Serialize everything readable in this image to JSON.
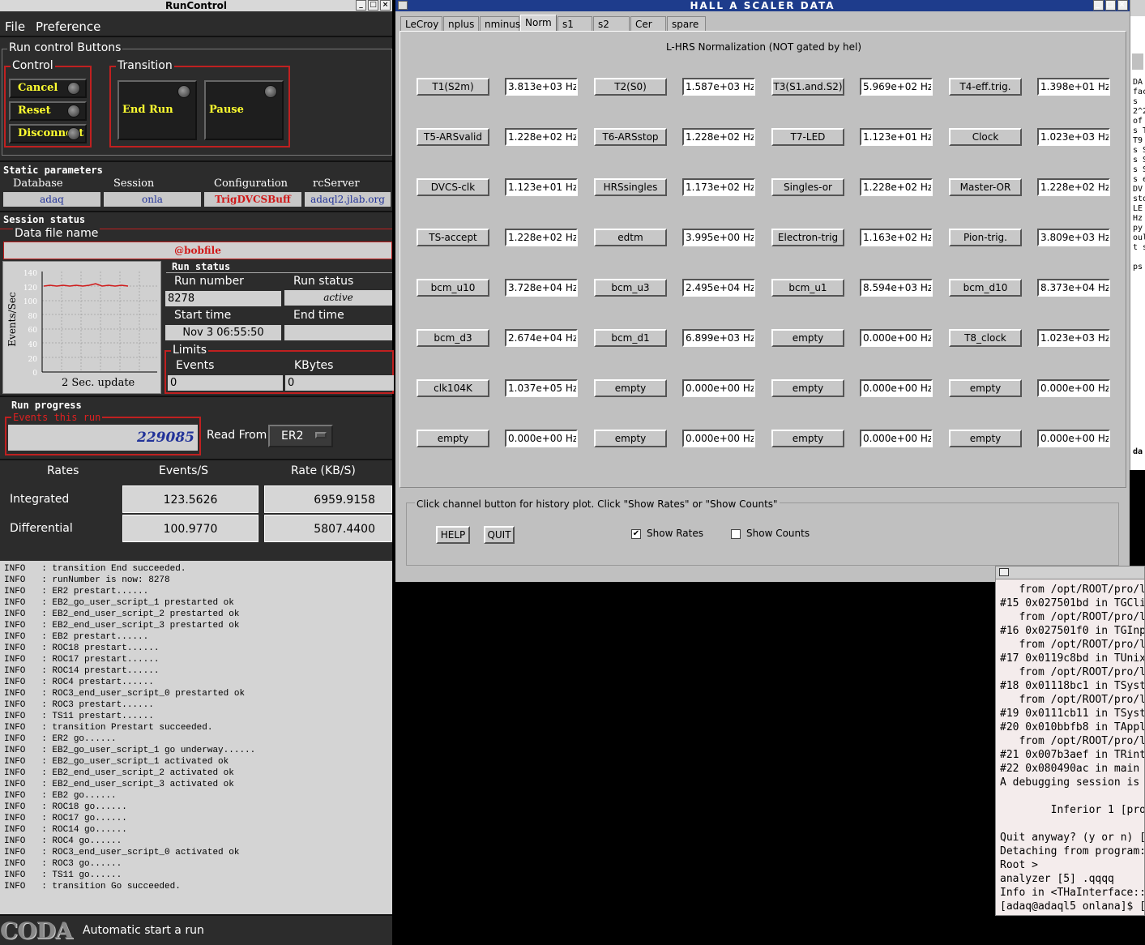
{
  "runcontrol": {
    "title": "RunControl",
    "menu": [
      "File",
      "Preference"
    ],
    "run_control_buttons_label": "Run control Buttons",
    "control_label": "Control",
    "control_buttons": [
      "Cancel",
      "Reset",
      "Disconnect"
    ],
    "transition_label": "Transition",
    "transition_buttons": [
      "End Run",
      "Pause"
    ],
    "static_params": {
      "label": "Static parameters",
      "headers": [
        "Database",
        "Session",
        "Configuration",
        "rcServer"
      ],
      "values": [
        "adaq",
        "onla",
        "TrigDVCSBuff",
        "adaql2.jlab.org"
      ]
    },
    "session_status": {
      "label": "Session status",
      "data_file_label": "Data file name",
      "data_file": "@bobfile"
    },
    "plot": {
      "ylabel": "Events/Sec",
      "yticks": [
        "140",
        "120",
        "100",
        "80",
        "60",
        "40",
        "20",
        "0"
      ],
      "caption": "2 Sec. update"
    },
    "run_status": {
      "label": "Run status",
      "run_number_label": "Run number",
      "run_number": "8278",
      "run_status_label": "Run status",
      "run_status": "active",
      "start_time_label": "Start time",
      "start_time": "Nov 3 06:55:50",
      "end_time_label": "End time",
      "end_time": ""
    },
    "limits": {
      "label": "Limits",
      "events_label": "Events",
      "events": "0",
      "kbytes_label": "KBytes",
      "kbytes": "0"
    },
    "run_progress": {
      "label": "Run progress",
      "events_label": "Events this run",
      "events": "229085",
      "read_from_label": "Read From:",
      "read_from": "ER2"
    },
    "rates": {
      "headers": [
        "Rates",
        "Events/S",
        "Rate (KB/S)"
      ],
      "rows": [
        {
          "label": "Integrated",
          "events": "123.5626",
          "rate": "6959.9158"
        },
        {
          "label": "Differential",
          "events": "100.9770",
          "rate": "5807.4400"
        }
      ]
    },
    "log": [
      "INFO   : transition End succeeded.",
      "INFO   : runNumber is now: 8278",
      "INFO   : ER2 prestart......",
      "INFO   : EB2_go_user_script_1 prestarted ok",
      "INFO   : EB2_end_user_script_2 prestarted ok",
      "INFO   : EB2_end_user_script_3 prestarted ok",
      "INFO   : EB2 prestart......",
      "INFO   : ROC18 prestart......",
      "INFO   : ROC17 prestart......",
      "INFO   : ROC14 prestart......",
      "INFO   : ROC4 prestart......",
      "INFO   : ROC3_end_user_script_0 prestarted ok",
      "INFO   : ROC3 prestart......",
      "INFO   : TS11 prestart......",
      "INFO   : transition Prestart succeeded.",
      "INFO   : ER2 go......",
      "INFO   : EB2_go_user_script_1 go underway......",
      "INFO   : EB2_go_user_script_1 activated ok",
      "INFO   : EB2_end_user_script_2 activated ok",
      "INFO   : EB2_end_user_script_3 activated ok",
      "INFO   : EB2 go......",
      "INFO   : ROC18 go......",
      "INFO   : ROC17 go......",
      "INFO   : ROC14 go......",
      "INFO   : ROC4 go......",
      "INFO   : ROC3_end_user_script_0 activated ok",
      "INFO   : ROC3 go......",
      "INFO   : TS11 go......",
      "INFO   : transition Go succeeded."
    ],
    "coda_logo": "CODA",
    "status_message": "Automatic start a run"
  },
  "scaler": {
    "title": "HALL A SCALER DATA",
    "tabs": [
      "LeCroy",
      "nplus",
      "nminus",
      "Norm",
      "s1",
      "s2",
      "Cer",
      "spare"
    ],
    "active_tab": "Norm",
    "heading": "L-HRS Normalization (NOT gated by hel)",
    "rows": [
      [
        {
          "name": "T1(S2m)",
          "value": "3.813e+03 Hz"
        },
        {
          "name": "T2(S0)",
          "value": "1.587e+03 Hz"
        },
        {
          "name": "T3(S1.and.S2)",
          "value": "5.969e+02 Hz"
        },
        {
          "name": "T4-eff.trig.",
          "value": "1.398e+01 Hz"
        }
      ],
      [
        {
          "name": "T5-ARSvalid",
          "value": "1.228e+02 Hz"
        },
        {
          "name": "T6-ARSstop",
          "value": "1.228e+02 Hz"
        },
        {
          "name": "T7-LED",
          "value": "1.123e+01 Hz"
        },
        {
          "name": "Clock",
          "value": "1.023e+03 Hz"
        }
      ],
      [
        {
          "name": "DVCS-clk",
          "value": "1.123e+01 Hz"
        },
        {
          "name": "HRSsingles",
          "value": "1.173e+02 Hz"
        },
        {
          "name": "Singles-or",
          "value": "1.228e+02 Hz"
        },
        {
          "name": "Master-OR",
          "value": "1.228e+02 Hz"
        }
      ],
      [
        {
          "name": "TS-accept",
          "value": "1.228e+02 Hz"
        },
        {
          "name": "edtm",
          "value": "3.995e+00 Hz"
        },
        {
          "name": "Electron-trig",
          "value": "1.163e+02 Hz"
        },
        {
          "name": "Pion-trig.",
          "value": "3.809e+03 Hz"
        }
      ],
      [
        {
          "name": "bcm_u10",
          "value": "3.728e+04 Hz"
        },
        {
          "name": "bcm_u3",
          "value": "2.495e+04 Hz"
        },
        {
          "name": "bcm_u1",
          "value": "8.594e+03 Hz"
        },
        {
          "name": "bcm_d10",
          "value": "8.373e+04 Hz"
        }
      ],
      [
        {
          "name": "bcm_d3",
          "value": "2.674e+04 Hz"
        },
        {
          "name": "bcm_d1",
          "value": "6.899e+03 Hz"
        },
        {
          "name": "empty",
          "value": "0.000e+00 Hz"
        },
        {
          "name": "T8_clock",
          "value": "1.023e+03 Hz"
        }
      ],
      [
        {
          "name": "clk104K",
          "value": "1.037e+05 Hz"
        },
        {
          "name": "empty",
          "value": "0.000e+00 Hz"
        },
        {
          "name": "empty",
          "value": "0.000e+00 Hz"
        },
        {
          "name": "empty",
          "value": "0.000e+00 Hz"
        }
      ],
      [
        {
          "name": "empty",
          "value": "0.000e+00 Hz"
        },
        {
          "name": "empty",
          "value": "0.000e+00 Hz"
        },
        {
          "name": "empty",
          "value": "0.000e+00 Hz"
        },
        {
          "name": "empty",
          "value": "0.000e+00 Hz"
        }
      ]
    ],
    "instructions": "Click channel button for history plot.  Click \"Show Rates\" or \"Show Counts\"",
    "help_label": "HELP",
    "quit_label": "QUIT",
    "show_rates_label": "Show Rates",
    "show_rates_checked": true,
    "show_counts_label": "Show Counts",
    "show_counts_checked": false
  },
  "background_window": {
    "lines": [
      "DA",
      "fac",
      "s",
      "2^2",
      "of",
      "s T",
      "T9",
      "s S",
      "s S",
      "s S",
      "s e",
      "DV",
      "sto",
      "LE",
      "Hz",
      "py",
      "oul",
      "t s",
      "",
      "ps"
    ],
    "bottom": "da"
  },
  "terminal": {
    "lines": [
      "   from /opt/ROOT/pro/l",
      "#15 0x027501bd in TGCli",
      "   from /opt/ROOT/pro/l",
      "#16 0x027501f0 in TGInp",
      "   from /opt/ROOT/pro/l",
      "#17 0x0119c8bd in TUnix",
      "   from /opt/ROOT/pro/l",
      "#18 0x01118bc1 in TSyst",
      "   from /opt/ROOT/pro/l",
      "#19 0x0111cb11 in TSyst",
      "#20 0x010bbfb8 in TAppl",
      "   from /opt/ROOT/pro/l",
      "#21 0x007b3aef in TRint",
      "#22 0x080490ac in main",
      "A debugging session is",
      "",
      "        Inferior 1 [pro",
      "",
      "Quit anyway? (y or n) [",
      "Detaching from program:",
      "Root >",
      "analyzer [5] .qqqq",
      "Info in <THaInterface::",
      "[adaq@adaql5 onlana]$ ["
    ]
  }
}
